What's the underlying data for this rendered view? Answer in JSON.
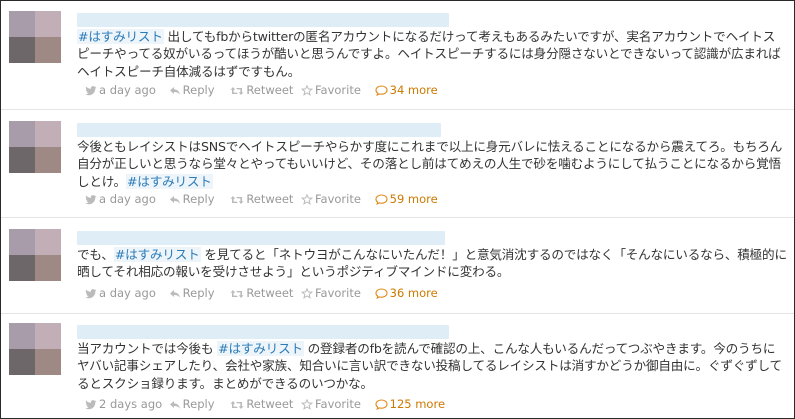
{
  "actions": {
    "reply": "Reply",
    "retweet": "Retweet",
    "favorite": "Favorite"
  },
  "colors": {
    "hashtag": "#2b7bb9",
    "more": "#cc7a00",
    "meta": "#999999"
  },
  "icons": {
    "time": "twitter-bird-icon",
    "reply": "reply-arrow-icon",
    "retweet": "retweet-icon",
    "favorite": "star-icon",
    "more": "conversation-icon"
  },
  "tweets": [
    {
      "parts": [
        {
          "text": "#はすみリスト",
          "tag": true
        },
        {
          "text": " 出してもfbからtwitterの匿名アカウントになるだけって考えもあるみたいですが、実名アカウントでヘイトスピーチやってる奴がいるってほうが酷いと思うんですよ。ヘイトスピーチするには身分隠さないとできないって認識が広まればヘイトスピーチ自体減るはずですもん。"
        }
      ],
      "time": "a day ago",
      "more": "34 more"
    },
    {
      "parts": [
        {
          "text": "今後ともレイシストはSNSでヘイトスピーチやらかす度にこれまで以上に身元バレに怯えることになるから震えてろ。もちろん自分が正しいと思うなら堂々とやってもいいけど、その落とし前はてめえの人生で砂を噛むようにして払うことになるから覚悟しとけ。"
        },
        {
          "text": "#はすみリスト",
          "tag": true
        }
      ],
      "time": "a day ago",
      "more": "59 more"
    },
    {
      "parts": [
        {
          "text": "でも、"
        },
        {
          "text": "#はすみリスト",
          "tag": true
        },
        {
          "text": " を見てると「ネトウヨがこんなにいたんだ！」と意気消沈するのではなく「そんなにいるなら、積極的に晒してそれ相応の報いを受けさせよう」というポジティブマインドに変わる。"
        }
      ],
      "time": "a day ago",
      "more": "36 more"
    },
    {
      "parts": [
        {
          "text": "当アカウントでは今後も "
        },
        {
          "text": "#はすみリスト",
          "tag": true
        },
        {
          "text": " の登録者のfbを読んで確認の上、こんな人もいるんだってつぶやきます。今のうちにヤバい記事シェアしたり、会社や家族、知合いに言い訳できない投稿してるレイシストは消すかどうか御自由に。ぐずぐずしてるとスクショ録ります。まとめができるのいつかな。"
        }
      ],
      "time": "2 days ago",
      "more": "125 more"
    }
  ]
}
